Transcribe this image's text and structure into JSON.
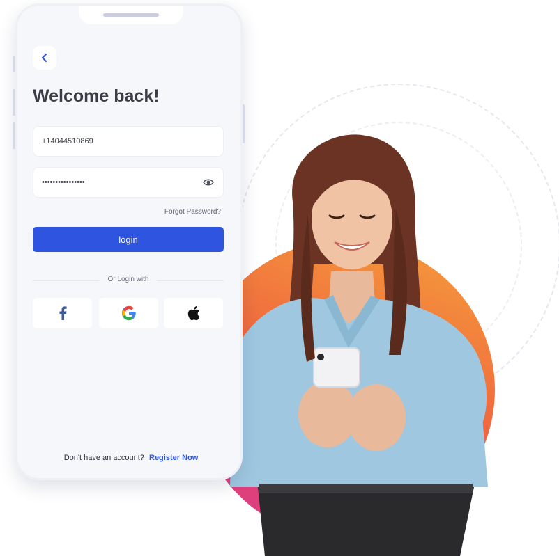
{
  "login": {
    "title": "Welcome back!",
    "phone_value": "+14044510869",
    "password_value": "••••••••••••••••",
    "forgot_password": "Forgot Password?",
    "login_button": "login",
    "or_login_with": "Or Login with",
    "no_account_text": "Don't have an account?",
    "register_link": "Register Now"
  },
  "icons": {
    "back": "chevron-left-icon",
    "password_toggle": "eye-icon",
    "social": [
      "facebook-icon",
      "google-icon",
      "apple-icon"
    ]
  },
  "colors": {
    "primary": "#2f54df",
    "title": "#3a3d46",
    "phone_bg": "#f6f7fb",
    "facebook": "#3b5998",
    "gradient_start": "#f5a13b",
    "gradient_end": "#d93f86"
  }
}
